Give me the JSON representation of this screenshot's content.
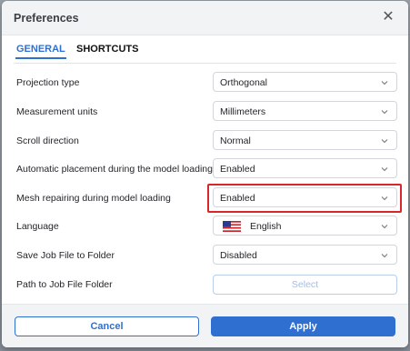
{
  "dialog": {
    "title": "Preferences",
    "close_icon": "close-icon"
  },
  "tabs": [
    {
      "label": "GENERAL",
      "active": true
    },
    {
      "label": "SHORTCUTS",
      "active": false
    }
  ],
  "settings": [
    {
      "label": "Projection type",
      "value": "Orthogonal"
    },
    {
      "label": "Measurement units",
      "value": "Millimeters"
    },
    {
      "label": "Scroll direction",
      "value": "Normal"
    },
    {
      "label": "Automatic placement during the model loading",
      "value": "Enabled"
    },
    {
      "label": "Mesh repairing during model loading",
      "value": "Enabled"
    },
    {
      "label": "Language",
      "value": "English",
      "icon": "us-flag-icon"
    },
    {
      "label": "Save Job File to Folder",
      "value": "Disabled"
    },
    {
      "label": "Path to Job File Folder",
      "button": "Select"
    }
  ],
  "footer": {
    "cancel_label": "Cancel",
    "apply_label": "Apply"
  },
  "colors": {
    "accent": "#2f6fd0",
    "highlight": "#d9262b",
    "header_bg": "#f2f3f5"
  }
}
